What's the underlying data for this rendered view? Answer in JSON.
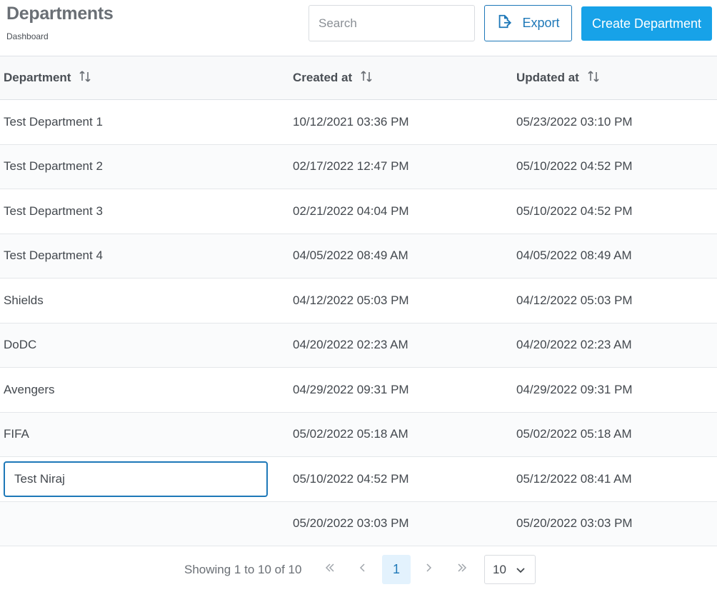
{
  "header": {
    "title": "Departments",
    "breadcrumb": "Dashboard",
    "search_placeholder": "Search",
    "export_label": "Export",
    "create_label": "Create Department"
  },
  "table": {
    "columns": [
      "Department",
      "Created at",
      "Updated at"
    ],
    "rows": [
      {
        "department": "Test Department 1",
        "created": "10/12/2021 03:36 PM",
        "updated": "05/23/2022 03:10 PM"
      },
      {
        "department": "Test Department 2",
        "created": "02/17/2022 12:47 PM",
        "updated": "05/10/2022 04:52 PM"
      },
      {
        "department": "Test Department 3",
        "created": "02/21/2022 04:04 PM",
        "updated": "05/10/2022 04:52 PM"
      },
      {
        "department": "Test Department 4",
        "created": "04/05/2022 08:49 AM",
        "updated": "04/05/2022 08:49 AM"
      },
      {
        "department": "Shields",
        "created": "04/12/2022 05:03 PM",
        "updated": "04/12/2022 05:03 PM"
      },
      {
        "department": "DoDC",
        "created": "04/20/2022 02:23 AM",
        "updated": "04/20/2022 02:23 AM"
      },
      {
        "department": "Avengers",
        "created": "04/29/2022 09:31 PM",
        "updated": "04/29/2022 09:31 PM"
      },
      {
        "department": "FIFA",
        "created": "05/02/2022 05:18 AM",
        "updated": "05/02/2022 05:18 AM"
      },
      {
        "department": "Test Niraj",
        "created": "05/10/2022 04:52 PM",
        "updated": "05/12/2022 08:41 AM",
        "editing": true
      },
      {
        "department": "",
        "created": "05/20/2022 03:03 PM",
        "updated": "05/20/2022 03:03 PM"
      }
    ]
  },
  "pagination": {
    "info": "Showing 1 to 10 of 10",
    "current_page": "1",
    "rows_per_page": "10"
  },
  "colors": {
    "primary": "#17a2e8",
    "outline": "#1e78b8"
  }
}
